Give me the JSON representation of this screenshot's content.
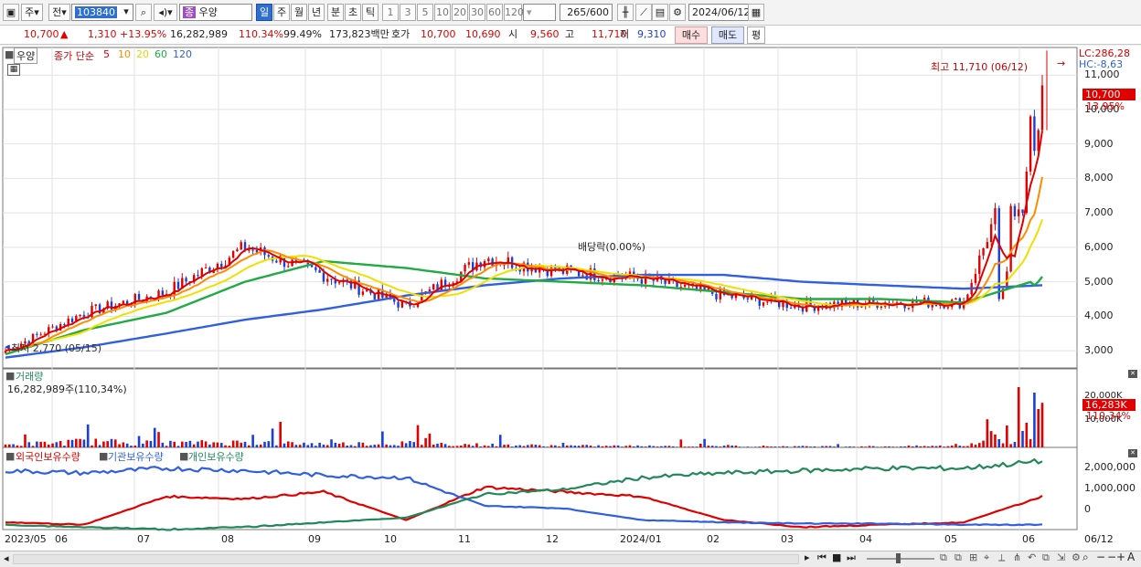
{
  "toolbar": {
    "type_label": "주",
    "prev_label": "전",
    "code": "103840",
    "stock_name_badge": "종",
    "stock_name": "우양",
    "periods": [
      "일",
      "주",
      "월",
      "년",
      "분",
      "초",
      "틱"
    ],
    "active_period": "일",
    "ticks": [
      "1",
      "3",
      "5",
      "10",
      "20",
      "30",
      "60",
      "120"
    ],
    "count": "265",
    "count_total": "/600",
    "date": "2024/06/12"
  },
  "quote": {
    "price": "10,700",
    "arrow": "▲",
    "change": "1,310",
    "change_pct": "+13.95%",
    "volume": "16,282,989",
    "volume_ratio": "110.34%",
    "strength": "99.49%",
    "amount": "173,823백만",
    "bid_label": "호가",
    "ask": "10,700",
    "bid": "10,690",
    "open_label": "시",
    "open": "9,560",
    "high_label": "고",
    "high": "11,710",
    "low_label": "저",
    "low": "9,310",
    "buy_label": "매수",
    "sell_label": "매도",
    "avg_label": "평"
  },
  "price_panel": {
    "name": "우양",
    "ma_label": "종가 단순",
    "ma_periods": [
      {
        "label": "5",
        "color": "#e00000"
      },
      {
        "label": "10",
        "color": "#ff8c00"
      },
      {
        "label": "20",
        "color": "#f0e000"
      },
      {
        "label": "60",
        "color": "#22aa44"
      },
      {
        "label": "120",
        "color": "#3060e0"
      }
    ],
    "lc_label": "LC:286,28",
    "hc_label": "HC:-8,63",
    "high_note": "최고 11,710 (06/12)",
    "low_note": "최저 2,770 (05/15)",
    "dividend_note": "배당락(0.00%)",
    "y_ticks": [
      "11,000",
      "10,000",
      "9,000",
      "8,000",
      "7,000",
      "6,000",
      "5,000",
      "4,000",
      "3,000"
    ],
    "current_tag": "10,700",
    "current_pct": "13.95%"
  },
  "volume_panel": {
    "title": "거래량",
    "summary": "16,282,989주(110,34%)",
    "y_ticks": [
      "20,000K",
      "10,000K"
    ],
    "current_tag": "16,283K",
    "current_pct": "110.34%"
  },
  "holding_panel": {
    "legends": [
      {
        "label": "외국인보유수량",
        "color": "#e00000"
      },
      {
        "label": "기관보유수량",
        "color": "#3060e0"
      },
      {
        "label": "개인보유수량",
        "color": "#22885a"
      }
    ],
    "y_ticks": [
      "2,000,000",
      "1,000,000",
      "0"
    ]
  },
  "x_axis": [
    "2023/05",
    "06",
    "07",
    "08",
    "09",
    "10",
    "11",
    "12",
    "2024/01",
    "02",
    "03",
    "04",
    "05",
    "06",
    "06/12"
  ],
  "colors": {
    "up": "#e00000",
    "down": "#1a3fd6",
    "ma5": "#e00000",
    "ma10": "#ff8c00",
    "ma20": "#f0e000",
    "ma60": "#22aa44",
    "ma120": "#3060e0"
  },
  "chart_data": {
    "type": "candlestick",
    "x": [
      "2023/05",
      "06",
      "07",
      "08",
      "09",
      "10",
      "11",
      "12",
      "2024/01",
      "02",
      "03",
      "04",
      "05",
      "06"
    ],
    "price_close": [
      3000,
      4100,
      4700,
      6000,
      5200,
      4300,
      5700,
      5300,
      5100,
      4600,
      4300,
      4400,
      4400,
      10700
    ],
    "ma120": [
      2800,
      3100,
      3500,
      3900,
      4200,
      4600,
      4900,
      5100,
      5200,
      5200,
      5000,
      4900,
      4800,
      4900
    ],
    "ma60": [
      2900,
      3600,
      4100,
      5000,
      5600,
      5400,
      5100,
      5000,
      4900,
      4700,
      4500,
      4500,
      4400,
      5100
    ],
    "volume_k": [
      1500,
      3500,
      2500,
      3000,
      2000,
      2500,
      1500,
      1000,
      800,
      800,
      600,
      600,
      900,
      16283
    ],
    "foreign": [
      -300000,
      -400000,
      800000,
      700000,
      1000000,
      -200000,
      1200000,
      1000000,
      800000,
      -200000,
      -500000,
      -400000,
      -300000,
      800000
    ],
    "institution": [
      1900000,
      1800000,
      2000000,
      1900000,
      1700000,
      1600000,
      400000,
      300000,
      -200000,
      -300000,
      -350000,
      -350000,
      -400000,
      -400000
    ],
    "individual": [
      -400000,
      -500000,
      -600000,
      -500000,
      -300000,
      -100000,
      900000,
      1100000,
      1600000,
      1800000,
      1900000,
      2000000,
      2000000,
      2300000
    ]
  }
}
